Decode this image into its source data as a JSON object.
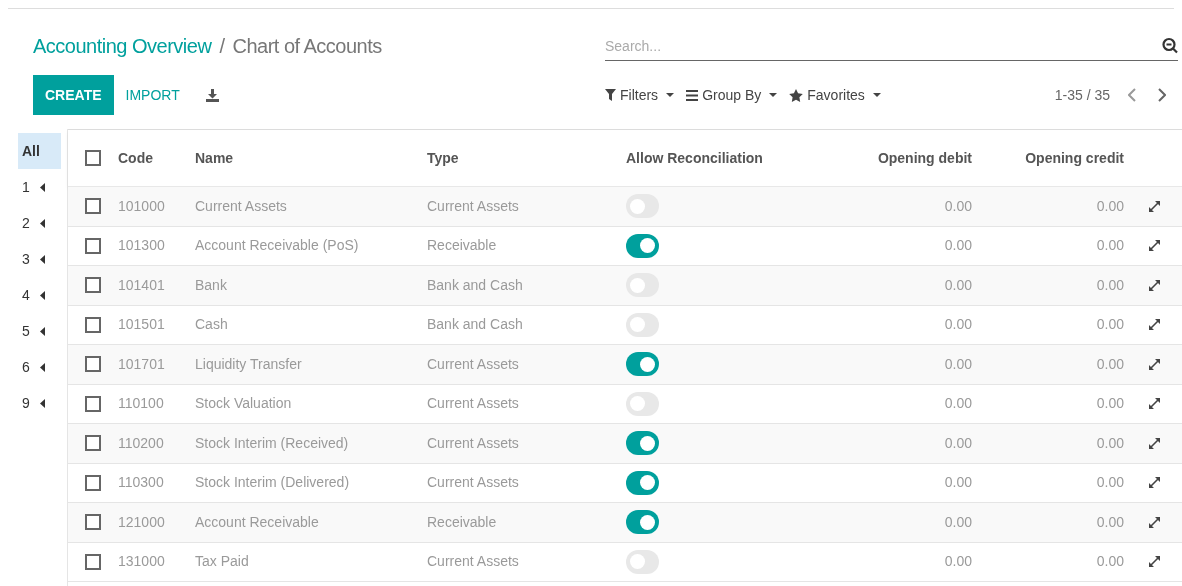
{
  "breadcrumb": {
    "parent": "Accounting Overview",
    "separator": "/",
    "current": "Chart of Accounts"
  },
  "buttons": {
    "create": "CREATE",
    "import": "IMPORT"
  },
  "search": {
    "placeholder": "Search..."
  },
  "search_options": [
    {
      "kind": "filter",
      "label": "Filters"
    },
    {
      "kind": "group",
      "label": "Group By"
    },
    {
      "kind": "favorite",
      "label": "Favorites"
    }
  ],
  "pager": "1-35 / 35",
  "sidebar": {
    "items": [
      {
        "label": "All",
        "selected": true,
        "expandable": false
      },
      {
        "label": "1",
        "selected": false,
        "expandable": true
      },
      {
        "label": "2",
        "selected": false,
        "expandable": true
      },
      {
        "label": "3",
        "selected": false,
        "expandable": true
      },
      {
        "label": "4",
        "selected": false,
        "expandable": true
      },
      {
        "label": "5",
        "selected": false,
        "expandable": true
      },
      {
        "label": "6",
        "selected": false,
        "expandable": true
      },
      {
        "label": "9",
        "selected": false,
        "expandable": true
      }
    ]
  },
  "table": {
    "select_all_checked": false,
    "columns": [
      "Code",
      "Name",
      "Type",
      "Allow Reconciliation",
      "Opening debit",
      "Opening credit"
    ],
    "rows": [
      {
        "checked": false,
        "code": "101000",
        "name": "Current Assets",
        "type": "Current Assets",
        "reconcile": false,
        "debit": "0.00",
        "credit": "0.00"
      },
      {
        "checked": false,
        "code": "101300",
        "name": "Account Receivable (PoS)",
        "type": "Receivable",
        "reconcile": true,
        "debit": "0.00",
        "credit": "0.00"
      },
      {
        "checked": false,
        "code": "101401",
        "name": "Bank",
        "type": "Bank and Cash",
        "reconcile": false,
        "debit": "0.00",
        "credit": "0.00"
      },
      {
        "checked": false,
        "code": "101501",
        "name": "Cash",
        "type": "Bank and Cash",
        "reconcile": false,
        "debit": "0.00",
        "credit": "0.00"
      },
      {
        "checked": false,
        "code": "101701",
        "name": "Liquidity Transfer",
        "type": "Current Assets",
        "reconcile": true,
        "debit": "0.00",
        "credit": "0.00"
      },
      {
        "checked": false,
        "code": "110100",
        "name": "Stock Valuation",
        "type": "Current Assets",
        "reconcile": false,
        "debit": "0.00",
        "credit": "0.00"
      },
      {
        "checked": false,
        "code": "110200",
        "name": "Stock Interim (Received)",
        "type": "Current Assets",
        "reconcile": true,
        "debit": "0.00",
        "credit": "0.00"
      },
      {
        "checked": false,
        "code": "110300",
        "name": "Stock Interim (Delivered)",
        "type": "Current Assets",
        "reconcile": true,
        "debit": "0.00",
        "credit": "0.00"
      },
      {
        "checked": false,
        "code": "121000",
        "name": "Account Receivable",
        "type": "Receivable",
        "reconcile": true,
        "debit": "0.00",
        "credit": "0.00"
      },
      {
        "checked": false,
        "code": "131000",
        "name": "Tax Paid",
        "type": "Current Assets",
        "reconcile": false,
        "debit": "0.00",
        "credit": "0.00"
      }
    ]
  }
}
